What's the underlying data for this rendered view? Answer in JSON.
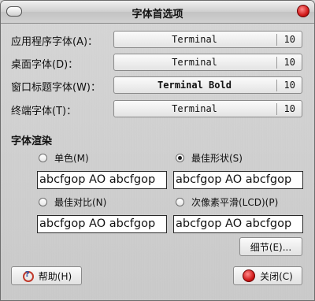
{
  "window": {
    "title": "字体首选项"
  },
  "fonts": [
    {
      "label": "应用程序字体(A)：",
      "font": "Terminal",
      "size": "10",
      "bold": false
    },
    {
      "label": "桌面字体(D)：",
      "font": "Terminal",
      "size": "10",
      "bold": false
    },
    {
      "label": "窗口标题字体(W)：",
      "font": "Terminal Bold",
      "size": "10",
      "bold": true
    },
    {
      "label": "终端字体(T)：",
      "font": "Terminal",
      "size": "10",
      "bold": false
    }
  ],
  "rendering": {
    "title": "字体渲染",
    "options": [
      {
        "label": "单色(M)",
        "checked": false,
        "sample": "abcfgop AO abcfgop"
      },
      {
        "label": "最佳形状(S)",
        "checked": true,
        "sample": "abcfgop AO abcfgop"
      },
      {
        "label": "最佳对比(N)",
        "checked": false,
        "sample": "abcfgop AO abcfgop"
      },
      {
        "label": "次像素平滑(LCD)(P)",
        "checked": false,
        "sample": "abcfgop AO abcfgop"
      }
    ]
  },
  "buttons": {
    "details": "细节(E)...",
    "help": "帮助(H)",
    "close": "关闭(C)"
  }
}
